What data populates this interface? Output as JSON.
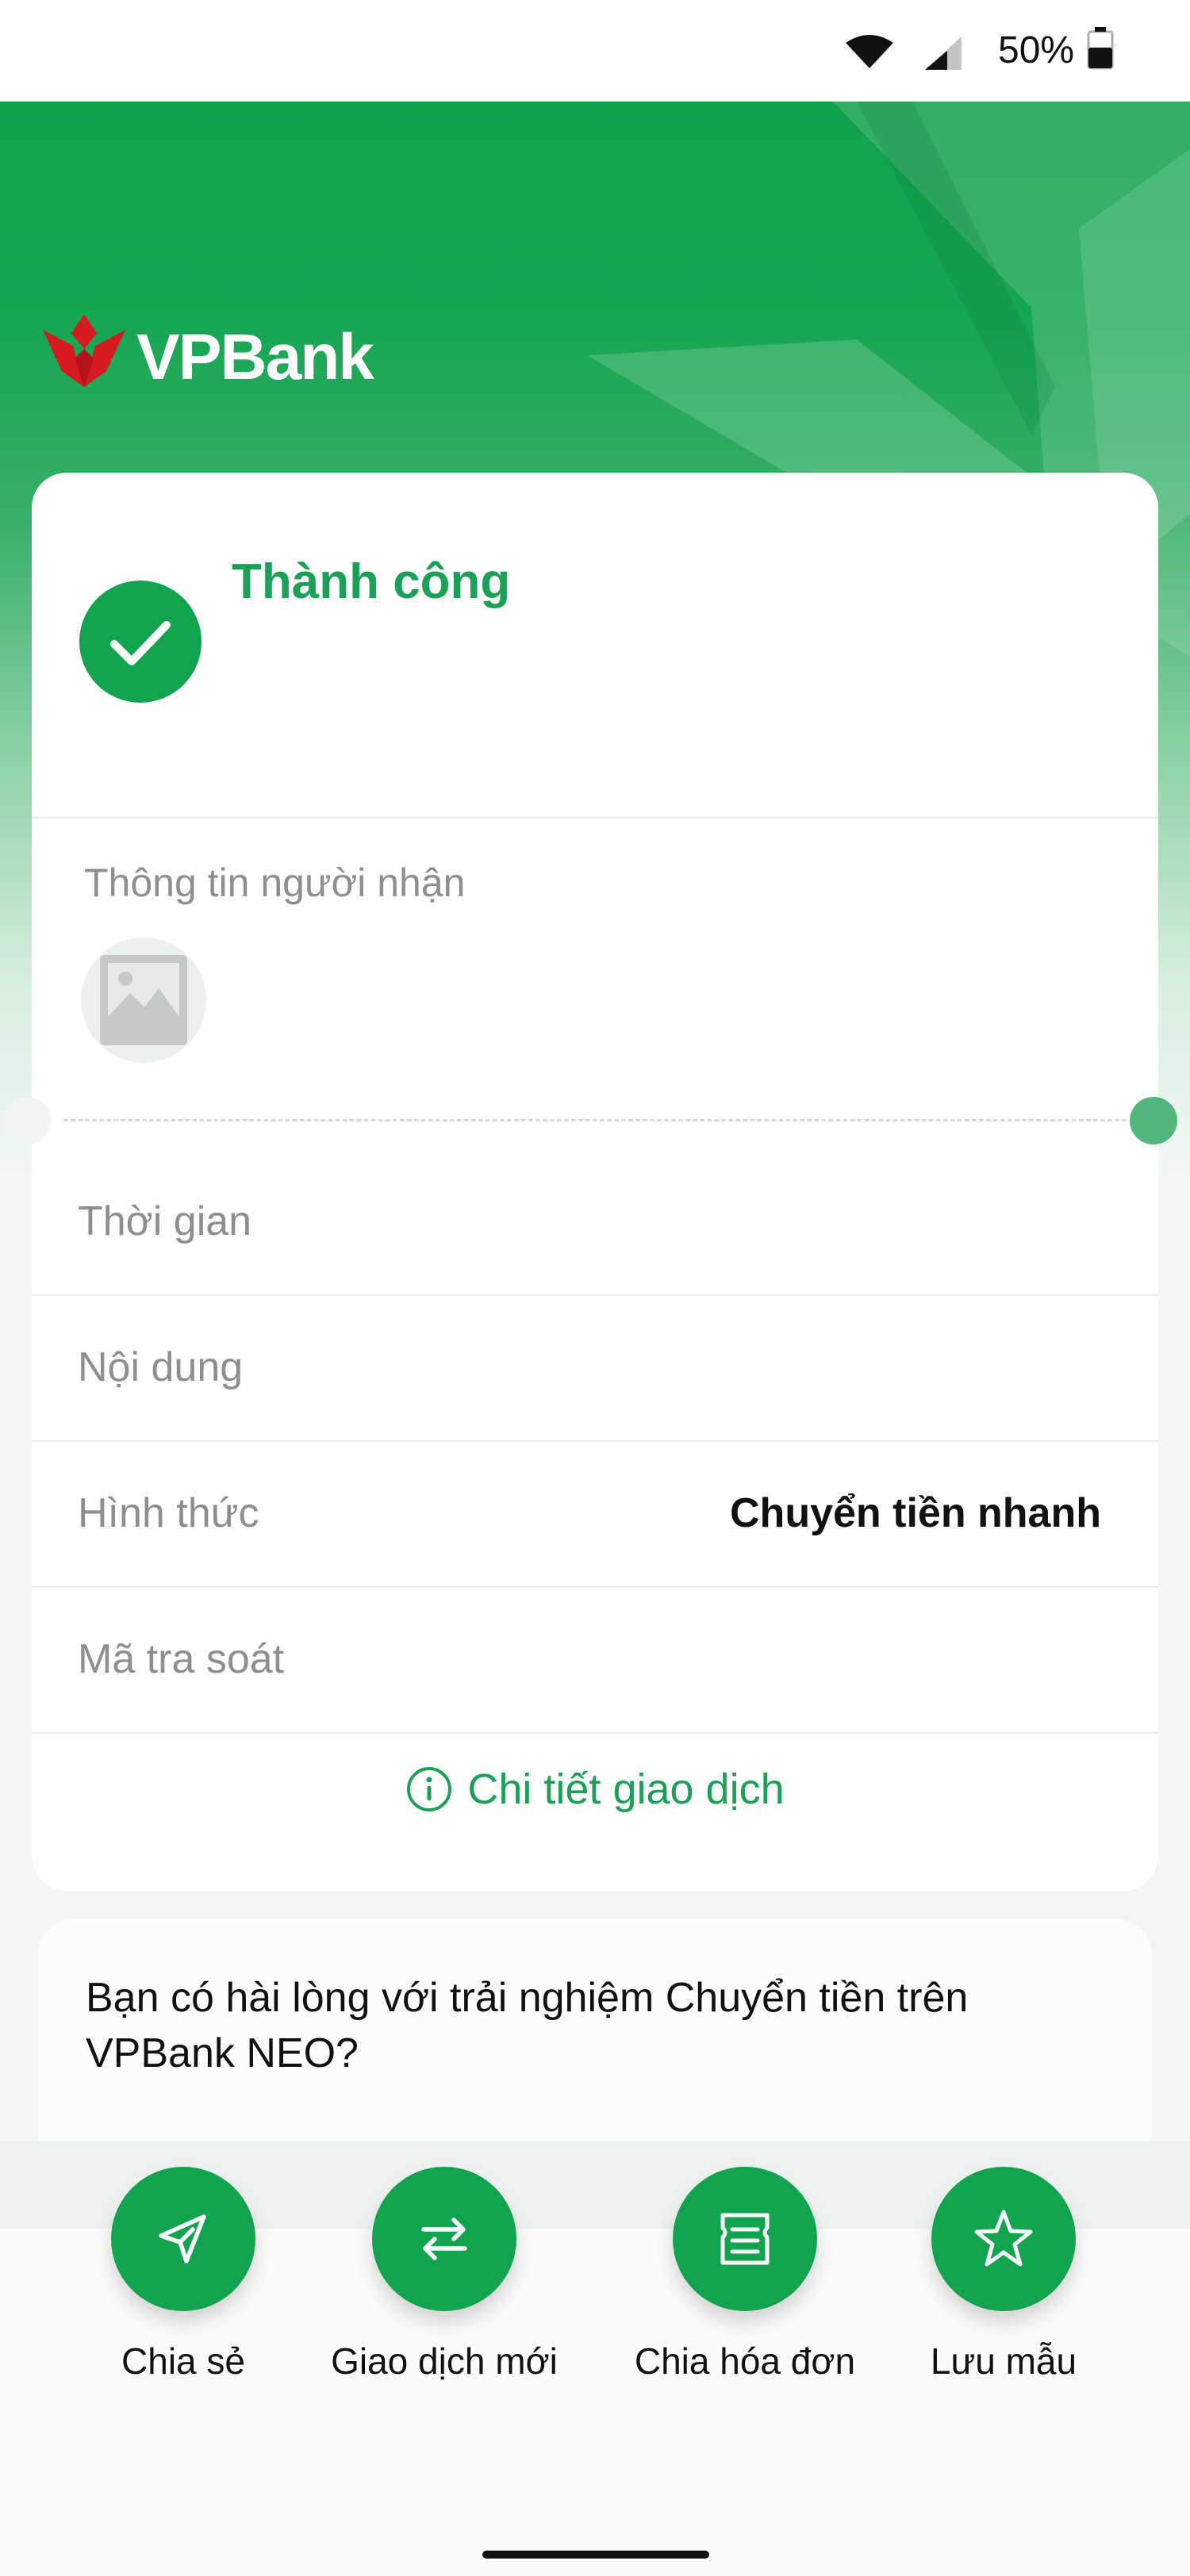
{
  "status_bar": {
    "battery_percent": "50%",
    "icons": [
      "wifi-icon",
      "cell-signal-icon",
      "battery-icon"
    ]
  },
  "brand": {
    "logo_text": "VPBank",
    "primary_color": "#12a34f",
    "accent_red": "#d71920"
  },
  "result": {
    "title": "Thành công",
    "icon": "check-icon"
  },
  "recipient": {
    "section_label": "Thông tin người nhận",
    "avatar_icon": "image-placeholder-icon"
  },
  "details": {
    "rows": [
      {
        "label": "Thời gian",
        "value": ""
      },
      {
        "label": "Nội dung",
        "value": ""
      },
      {
        "label": "Hình thức",
        "value": "Chuyển tiền nhanh"
      },
      {
        "label": "Mã tra soát",
        "value": ""
      }
    ],
    "detail_link": "Chi tiết giao dịch"
  },
  "feedback": {
    "question": "Bạn có hài lòng với trải nghiệm Chuyển tiền trên VPBank NEO?"
  },
  "actions": [
    {
      "label": "Chia sẻ",
      "icon": "send-icon"
    },
    {
      "label": "Giao dịch mới",
      "icon": "swap-arrows-icon"
    },
    {
      "label": "Chia hóa đơn",
      "icon": "split-bill-icon"
    },
    {
      "label": "Lưu mẫu",
      "icon": "star-icon"
    }
  ]
}
